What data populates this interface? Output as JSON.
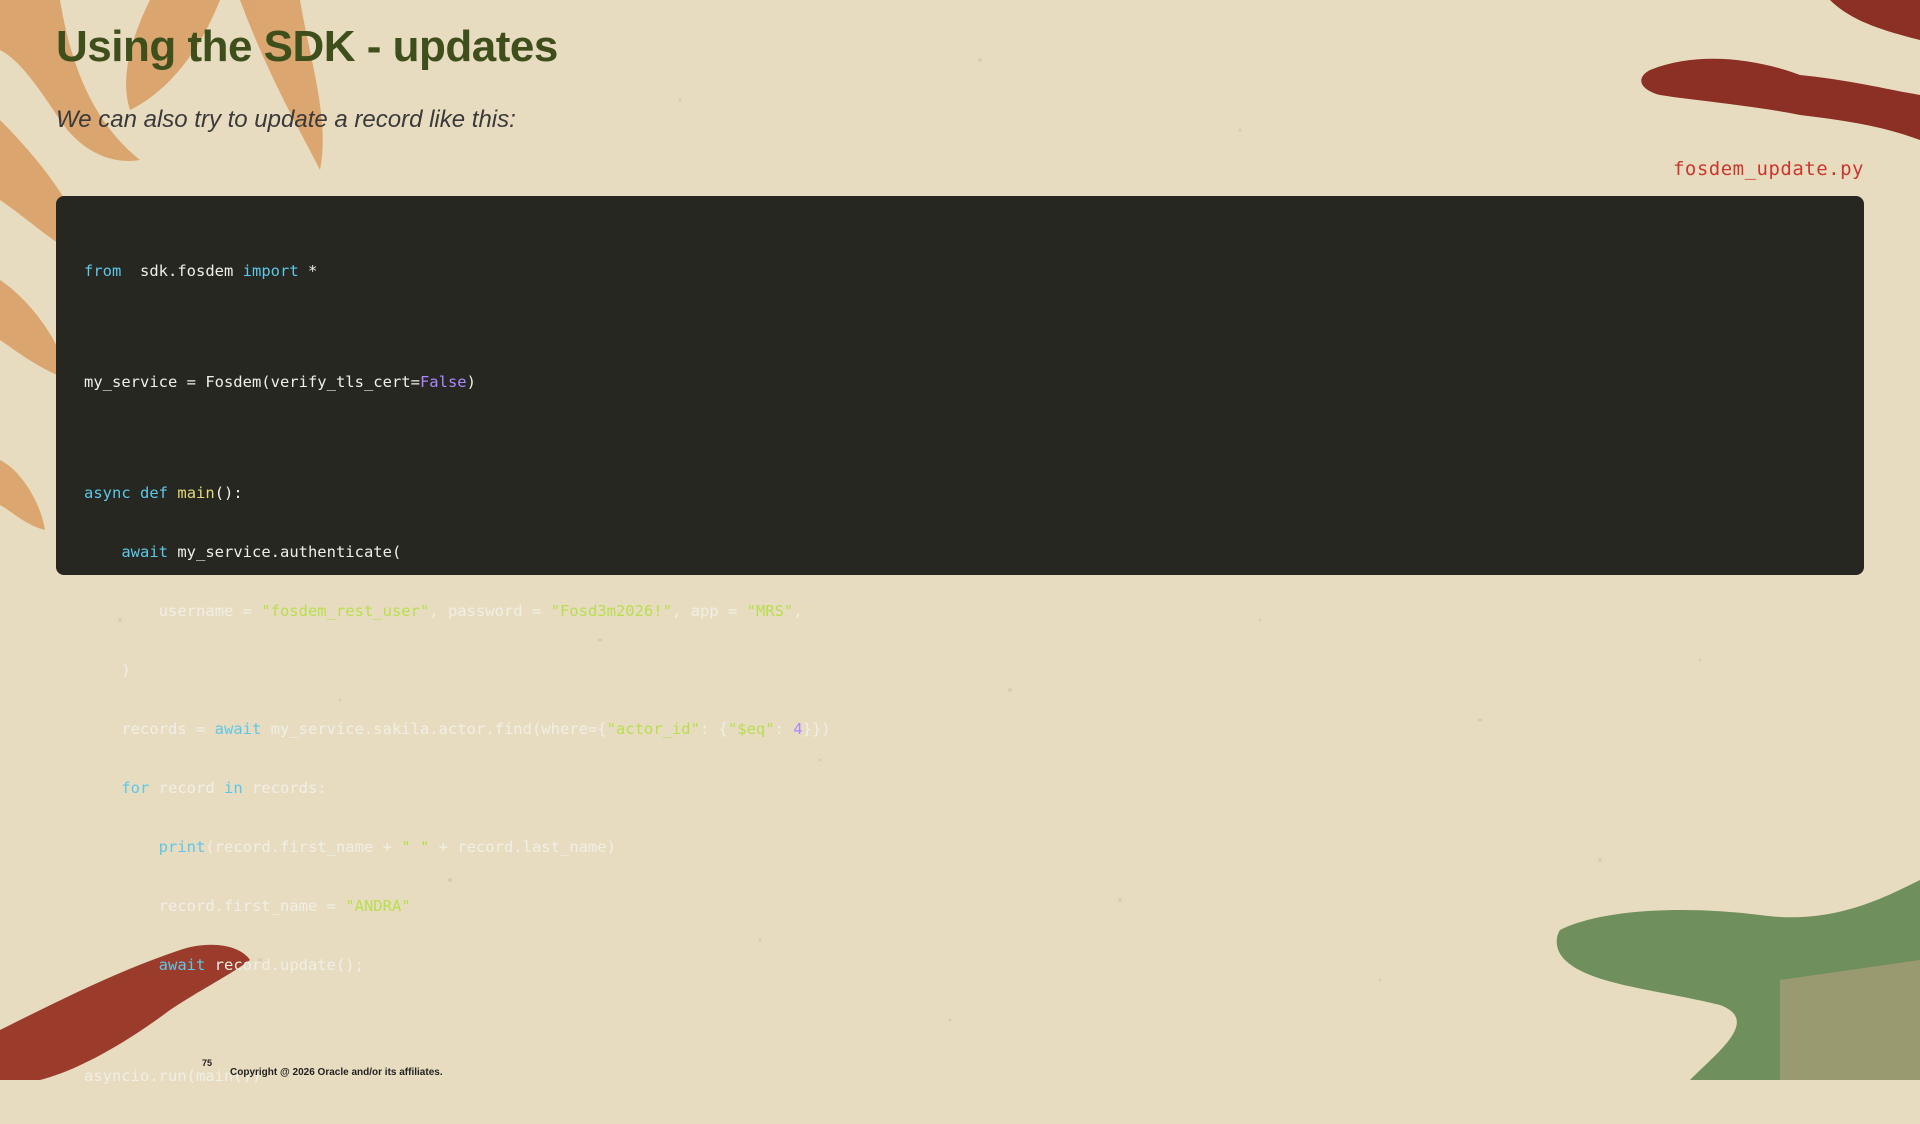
{
  "slide": {
    "title": "Using the SDK - updates",
    "subtitle": "We can also try to update a record like this:",
    "filename": "fosdem_update.py",
    "page_number": "75",
    "copyright": "Copyright @ 2026 Oracle and/or its affiliates."
  },
  "code": {
    "l1": {
      "a": "from",
      "b": "  sdk.fosdem ",
      "c": "import",
      "d": " *"
    },
    "l2": {
      "a": "my_service = Fosdem(verify_tls_cert=",
      "b": "False",
      "c": ")"
    },
    "l3": {
      "a": "async",
      "b": " ",
      "c": "def",
      "d": " ",
      "e": "main",
      "f": "():"
    },
    "l4": {
      "a": "    ",
      "b": "await",
      "c": " my_service.authenticate("
    },
    "l5": {
      "a": "        username = ",
      "b": "\"fosdem_rest_user\"",
      "c": ", password = ",
      "d": "\"Fosd3m2026!\"",
      "e": ", app = ",
      "f": "\"MRS\"",
      "g": ","
    },
    "l6": {
      "a": "    )"
    },
    "l7": {
      "a": "    records = ",
      "b": "await",
      "c": " my_service.sakila.actor.find(where={",
      "d": "\"actor_id\"",
      "e": ": {",
      "f": "\"$eq\"",
      "g": ": ",
      "h": "4",
      "i": "}})"
    },
    "l8": {
      "a": "    ",
      "b": "for",
      "c": " record ",
      "d": "in",
      "e": " records:"
    },
    "l9": {
      "a": "        ",
      "b": "print",
      "c": "(record.first_name + ",
      "d": "\" \"",
      "e": " + record.last_name)"
    },
    "l10": {
      "a": "        record.first_name = ",
      "b": "\"ANDRA\""
    },
    "l11": {
      "a": "        ",
      "b": "await",
      "c": " record.update();"
    },
    "l12": {
      "a": "asyncio.run(main())"
    }
  },
  "colors": {
    "title": "#3f4f1c",
    "filename": "#c9372c",
    "code_bg": "#262721",
    "keyword": "#5ec7e8",
    "string": "#b7df4f",
    "number": "#ae87ff",
    "function": "#e6d774"
  }
}
